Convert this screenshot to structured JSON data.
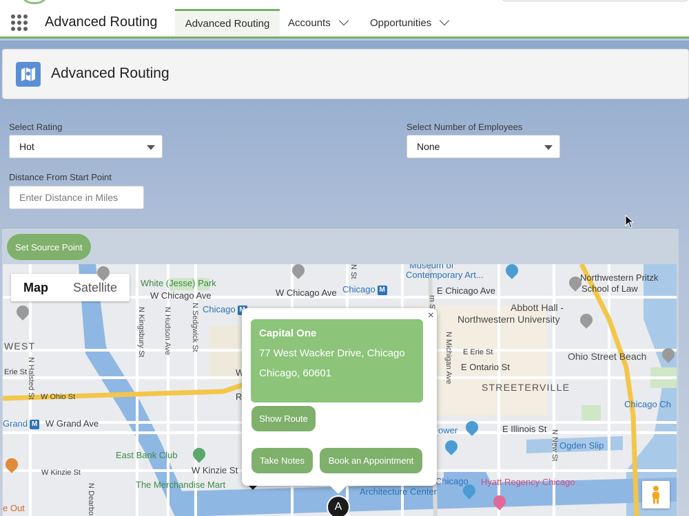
{
  "nav": {
    "app_name": "Advanced Routing",
    "tabs": [
      {
        "label": "Advanced Routing",
        "active": true
      },
      {
        "label": "Accounts",
        "has_menu": true
      },
      {
        "label": "Opportunities",
        "has_menu": true
      }
    ]
  },
  "header": {
    "title": "Advanced Routing",
    "icon": "map-route-icon"
  },
  "filters": {
    "rating_label": "Select Rating",
    "rating_value": "Hot",
    "employees_label": "Select Number of Employees",
    "employees_value": "None",
    "distance_label": "Distance From Start Point",
    "distance_placeholder": "Enter Distance in Miles"
  },
  "map": {
    "source_button": "Set Source Point",
    "map_types": [
      "Map",
      "Satellite"
    ],
    "labels": {
      "white_park": "White (Jesse) Park",
      "w_chicago_ave_1": "W Chicago Ave",
      "w_chicago_ave_2": "W Chicago Ave",
      "chicago_1": "Chicago",
      "chicago_2": "Chicago",
      "museum": "Museum of",
      "contemporary_art": "Contemporary Art...",
      "e_chicago_ave": "E Chicago Ave",
      "northwestern_pritzker": "Northwestern Pritzk",
      "school_of_law": "School of Law",
      "abbott_hall": "Abbott Hall -",
      "northwestern_univ": "Northwestern University",
      "west": "WEST",
      "erie_st_w": "Erie St",
      "e_erie_st": "E Erie St",
      "e_ontario_st": "E Ontario St",
      "ohio_street_beach": "Ohio Street Beach",
      "streeterville": "STREETERVILLE",
      "w_ohio_st": "W Ohio St",
      "chicago_ch": "Chicago Ch",
      "grand": "Grand",
      "w_grand_ave": "W Grand Ave",
      "power": "ower",
      "e_illinois_st": "E Illinois St",
      "ogden_slip": "Ogden Slip",
      "east_bank_club": "East Bank Club",
      "w_kinzie_st_1": "W Kinzie St",
      "w_kinzie_st_2": "W Kinzie St",
      "merchandise_mart": "The Merchandise Mart",
      "chicago_3": "Chicago",
      "architecture_center": "Architecture Center",
      "hyatt": "Hyatt Regency Chicago",
      "e_out": "e Out",
      "w_label": "W",
      "r_label": "R",
      "n_kingsbury": "N Kingsbury St",
      "n_hudson": "N Hudson Ave",
      "n_sedgwick": "N Sedgwick St",
      "n_halsted": "N Halsted St",
      "n_michigan": "N Michigan Ave",
      "n_new_st": "N New St",
      "n_dearborn": "N Dearborn St",
      "n_st": "N St",
      "rn_st": "rn St"
    },
    "marker_letter": "A"
  },
  "info_window": {
    "name": "Capital One",
    "address_line1": "77 West Wacker Drive, Chicago",
    "address_line2": "Chicago, 60601",
    "show_route": "Show Route",
    "take_notes": "Take Notes",
    "book_appointment": "Book an Appointment",
    "close_symbol": "×"
  },
  "colors": {
    "accent_green": "#7fb06c",
    "card_green": "#8cc47a",
    "header_icon_blue": "#5a8fd6"
  }
}
